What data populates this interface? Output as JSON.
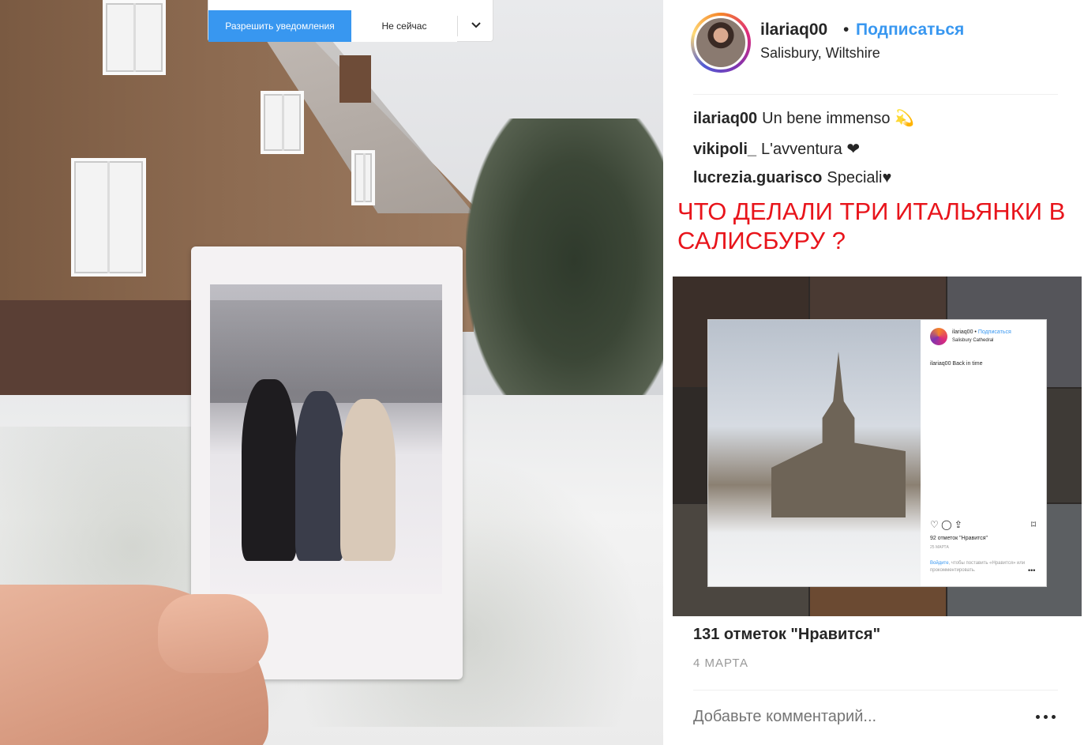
{
  "notification": {
    "allow_label": "Разрешить уведомления",
    "later_label": "Не сейчас"
  },
  "post": {
    "username": "ilariaq00",
    "separator": "•",
    "follow_label": "Подписаться",
    "location": "Salisbury, Wiltshire",
    "comments": [
      {
        "user": "ilariaq00",
        "text": "Un bene immenso 💫"
      },
      {
        "user": "vikipoli_",
        "text": "L'avventura ❤"
      },
      {
        "user": "lucrezia.guarisco",
        "text": "Speciali♥"
      }
    ],
    "likes": "131 отметок \"Нравится\"",
    "date": "4 МАРТА",
    "comment_placeholder": "Добавьте комментарий..."
  },
  "overlay_headline": "ЧТО ДЕЛАЛИ ТРИ ИТАЛЬЯНКИ В САЛИСБУРУ ?",
  "embedded_post": {
    "username": "ilariaq00",
    "follow_label": "Подписаться",
    "location": "Salisbury Cathedral",
    "caption": "ilariaq00 Back in time",
    "likes": "92 отметок \"Нравится\"",
    "date": "25 МАРТА",
    "login_link": "Войдите",
    "login_text": ", чтобы поставить «Нравится» или прокомментировать."
  },
  "colors": {
    "accent": "#3897f0",
    "headline": "#e8141b",
    "text": "#262626",
    "muted": "#999999"
  },
  "icons": [
    "chevron-down-icon",
    "heart-icon",
    "comment-icon",
    "share-icon",
    "bookmark-icon",
    "more-icon",
    "sparkle-emoji"
  ]
}
